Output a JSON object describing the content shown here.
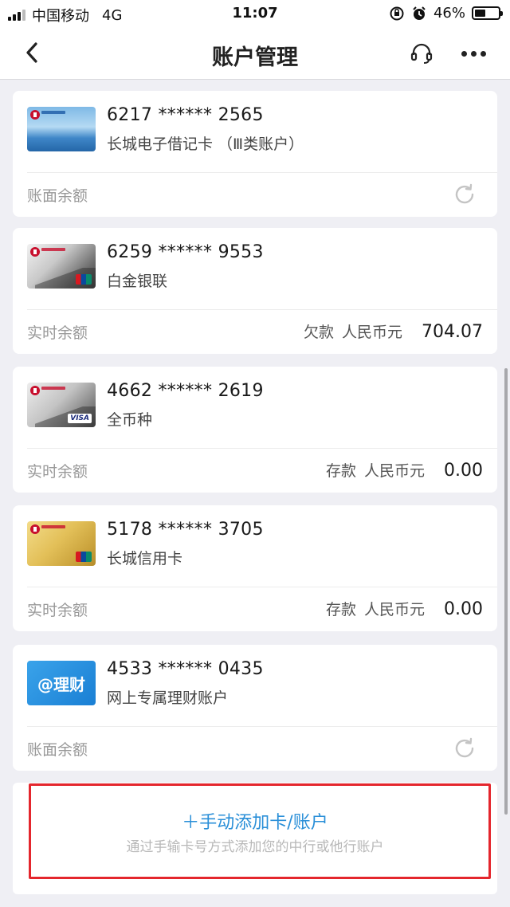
{
  "status_bar": {
    "carrier": "中国移动",
    "network": "4G",
    "time": "11:07",
    "battery_percent": "46%",
    "battery_level": 0.46
  },
  "nav": {
    "title": "账户管理",
    "back_icon": "chevron-left-icon",
    "service_icon": "headset-icon",
    "more_icon": "more-horizontal-icon"
  },
  "accounts": [
    {
      "number": "6217 ****** 2565",
      "name": "长城电子借记卡 （Ⅲ类账户）",
      "balance_label": "账面余额",
      "balance_type": "",
      "currency": "",
      "amount": "",
      "action_icon": "refresh-icon"
    },
    {
      "number": "6259 ****** 9553",
      "name": "白金银联",
      "balance_label": "实时余额",
      "balance_type": "欠款",
      "currency": "人民币元",
      "amount": "704.07"
    },
    {
      "number": "4662 ****** 2619",
      "name": "全币种",
      "balance_label": "实时余额",
      "balance_type": "存款",
      "currency": "人民币元",
      "amount": "0.00"
    },
    {
      "number": "5178 ****** 3705",
      "name": "长城信用卡",
      "balance_label": "实时余额",
      "balance_type": "存款",
      "currency": "人民币元",
      "amount": "0.00"
    },
    {
      "number": "4533 ****** 0435",
      "name": "网上专属理财账户",
      "thumb_text": "@理财",
      "balance_label": "账面余额",
      "balance_type": "",
      "currency": "",
      "amount": "",
      "action_icon": "refresh-icon"
    }
  ],
  "add_account": {
    "title": "＋手动添加卡/账户",
    "subtitle": "通过手输卡号方式添加您的中行或他行账户"
  },
  "colors": {
    "accent_blue": "#2a8fd8",
    "highlight_red": "#e4262d",
    "background": "#efeff4"
  }
}
